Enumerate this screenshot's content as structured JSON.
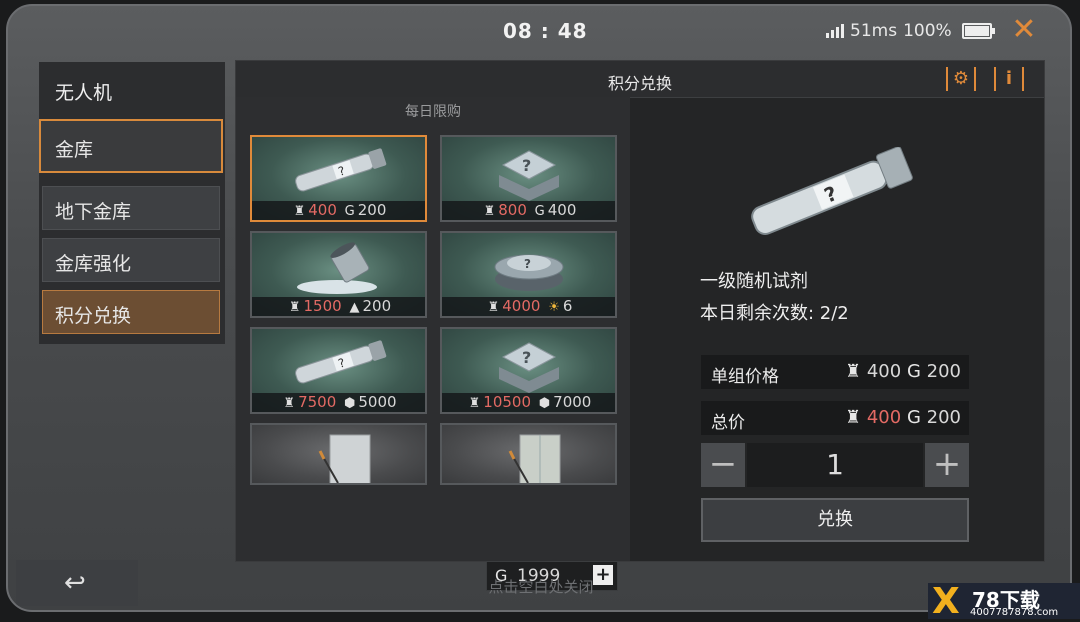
{
  "status": {
    "time": "08 : 48",
    "ping": "51ms",
    "battery": "100%"
  },
  "sidebar": {
    "title": "无人机",
    "vault_label": "金库",
    "items": [
      {
        "label": "地下金库"
      },
      {
        "label": "金库强化"
      },
      {
        "label": "积分兑换"
      }
    ]
  },
  "panel": {
    "title": "积分兑换",
    "section": "每日限购"
  },
  "shop": {
    "items": [
      {
        "price1": "400",
        "price2": "200",
        "icon1": "vault-token-icon",
        "icon2": "coin-icon",
        "art": "syringe-icon"
      },
      {
        "price1": "800",
        "price2": "400",
        "icon1": "vault-token-icon",
        "icon2": "coin-icon",
        "art": "mystery-box-icon"
      },
      {
        "price1": "1500",
        "price2": "200",
        "icon1": "vault-token-icon",
        "icon2": "gold-bar-icon",
        "art": "paint-bucket-icon"
      },
      {
        "price1": "4000",
        "price2": "6",
        "icon1": "vault-token-icon",
        "icon2": "sun-icon",
        "art": "mystery-chest-icon"
      },
      {
        "price1": "7500",
        "price2": "5000",
        "icon1": "vault-token-icon",
        "icon2": "cube-icon",
        "art": "syringe-icon"
      },
      {
        "price1": "10500",
        "price2": "7000",
        "icon1": "vault-token-icon",
        "icon2": "cube-icon",
        "art": "mystery-box-icon"
      }
    ],
    "coins": "1999"
  },
  "detail": {
    "name": "一级随机试剂",
    "remaining": "本日剩余次数: 2/2",
    "unit_price_label": "单组价格",
    "unit_price_1": "400",
    "unit_price_2": "200",
    "total_label": "总价",
    "total_1": "400",
    "total_2": "200",
    "quantity": "1",
    "exchange_label": "兑换"
  },
  "footer": {
    "hint": "点击空白处关闭"
  },
  "watermark": {
    "brand": "78下载",
    "url": "4007787878.com"
  }
}
